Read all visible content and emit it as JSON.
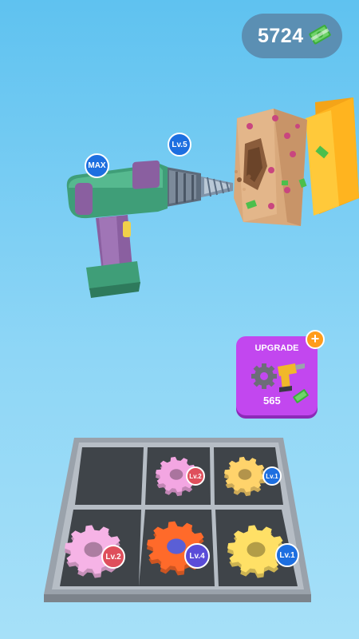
{
  "currency": {
    "amount": "5724",
    "icon": "cash-icon"
  },
  "drill": {
    "max_badge": "MAX",
    "bit_level": "Lv.5"
  },
  "upgrade": {
    "label": "UPGRADE",
    "cost": "565",
    "plus": "+"
  },
  "tray": {
    "slots": [
      {
        "empty": true
      },
      {
        "gear_color": "#f3a6e2",
        "level": "Lv.2",
        "badge_color": "#df4f5c"
      },
      {
        "gear_color": "#ffd36b",
        "level": "Lv.1",
        "badge_color": "#1d6fe0"
      },
      {
        "gear_color": "#f6b3e6",
        "level": "Lv.2",
        "badge_color": "#df4f5c"
      },
      {
        "gear_color": "#ff6a2a",
        "level": "Lv.4",
        "badge_color": "#5a4cd8"
      },
      {
        "gear_color": "#ffe066",
        "level": "Lv.1",
        "badge_color": "#1d6fe0"
      }
    ]
  },
  "colors": {
    "sky": "#7fcff3",
    "upgrade_card": "#c247ef",
    "drill_body": "#3f9e78",
    "drill_grip": "#8a5fa0"
  }
}
